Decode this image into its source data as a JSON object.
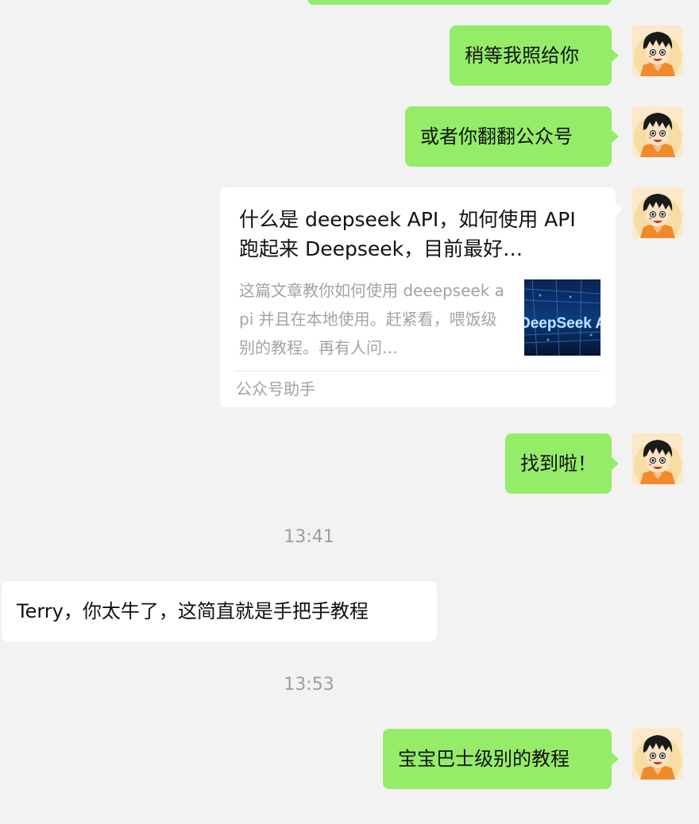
{
  "messages": {
    "m1": "稍等我照给你",
    "m2": "或者你翻翻公众号",
    "m3": "找到啦！",
    "m4": "Terry，你太牛了，这简直就是手把手教程",
    "m5": "宝宝巴士级别的教程"
  },
  "article": {
    "title": "什么是 deepseek API，如何使用 API跑起来 Deepseek，目前最好…",
    "description": "这篇文章教你如何使用 deeepseek api 并且在本地使用。赶紧看，喂饭级别的教程。再有人问…",
    "thumbnail_text": "DeepSeek A",
    "source": "公众号助手"
  },
  "timestamps": {
    "t1": "13:41",
    "t2": "13:53"
  },
  "colors": {
    "background": "#f2f2f2",
    "sent_bubble": "#95ec69",
    "received_bubble": "#ffffff"
  },
  "icons": {
    "avatar": "luffy-avatar"
  }
}
